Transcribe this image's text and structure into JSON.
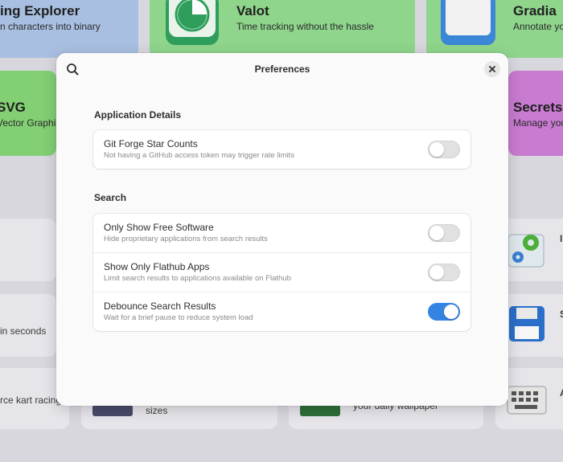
{
  "background": {
    "tiles": [
      {
        "title": "ing Explorer",
        "subtitle": "n characters into binary",
        "color": "#a8bfe1"
      },
      {
        "title": "Valot",
        "subtitle": "Time tracking without the hassle",
        "color": "#8fd58c"
      },
      {
        "title": "Gradia",
        "subtitle": "Annotate yo",
        "color": "#8fd58c"
      },
      {
        "title": "SVG",
        "subtitle": "Vector Graphi",
        "color": "#82cf74"
      },
      {
        "title": "Secrets",
        "subtitle": "Manage you",
        "color": "#c87bd0"
      }
    ],
    "cards": [
      {
        "text": "in seconds"
      },
      {
        "text": "rce kart racing"
      },
      {
        "text": "sizes"
      },
      {
        "text": "your daily wallpaper"
      },
      {
        "text": "I"
      },
      {
        "text": "S"
      },
      {
        "text": "A"
      }
    ]
  },
  "dialog": {
    "title": "Preferences",
    "sections": [
      {
        "title": "Application Details",
        "rows": [
          {
            "title": "Git Forge Star Counts",
            "subtitle": "Not having a GitHub access token may trigger rate limits",
            "enabled": false
          }
        ]
      },
      {
        "title": "Search",
        "rows": [
          {
            "title": "Only Show Free Software",
            "subtitle": "Hide proprietary applications from search results",
            "enabled": false
          },
          {
            "title": "Show Only Flathub Apps",
            "subtitle": "Limit search results to applications available on Flathub",
            "enabled": false
          },
          {
            "title": "Debounce Search Results",
            "subtitle": "Wait for a brief pause to reduce system load",
            "enabled": true
          }
        ]
      }
    ]
  },
  "colors": {
    "accent": "#3584e4"
  }
}
